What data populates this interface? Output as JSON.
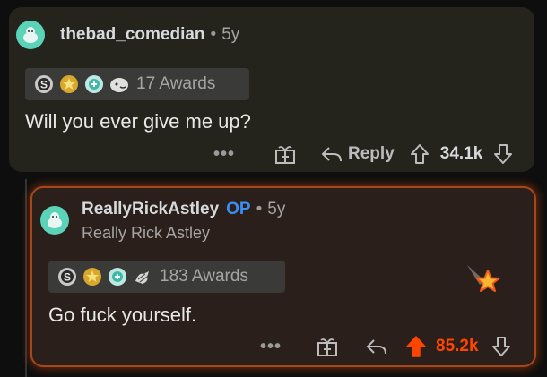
{
  "comment1": {
    "username": "thebad_comedian",
    "separator": "•",
    "age": "5y",
    "awards_label": "17 Awards",
    "award_icons": [
      "silver-award-icon",
      "helpful-award-icon",
      "wholesome-award-icon",
      "rocket-like-award-icon"
    ],
    "body": "Will you ever give me up?",
    "more": "•••",
    "reply_label": "Reply",
    "vote_count": "34.1k"
  },
  "comment2": {
    "username": "ReallyRickAstley",
    "op_badge": "OP",
    "separator": "•",
    "age": "5y",
    "flair": "Really Rick Astley",
    "awards_label": "183 Awards",
    "award_icons": [
      "silver-award-icon",
      "helpful-award-icon",
      "wholesome-award-icon",
      "hugz-award-icon"
    ],
    "body": "Go fuck yourself.",
    "more": "•••",
    "vote_count": "85.2k",
    "vote_state": "upvoted"
  },
  "colors": {
    "upvote_orange": "#ff4500",
    "op_blue": "#3b8ff2",
    "avatar_teal": "#5ad3b8",
    "highlight_border": "#a8451b"
  }
}
